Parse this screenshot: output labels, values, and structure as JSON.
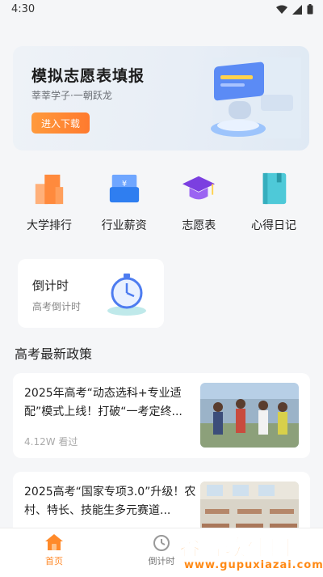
{
  "status_bar": {
    "time": "4:30"
  },
  "banner": {
    "title": "模拟志愿表填报",
    "subtitle": "莘莘学子·一朝跃龙",
    "button": "进入下载"
  },
  "quick_grid": [
    {
      "label": "大学排行",
      "icon": "building-icon",
      "color": "#ff8a3d"
    },
    {
      "label": "行业薪资",
      "icon": "salary-envelope-icon",
      "color": "#2f7ef0"
    },
    {
      "label": "志愿表",
      "icon": "graduation-cap-icon",
      "color": "#7b3fe0"
    },
    {
      "label": "心得日记",
      "icon": "notebook-icon",
      "color": "#4ec9d8"
    }
  ],
  "countdown_card": {
    "title": "倒计时",
    "subtitle": "高考倒计时"
  },
  "section": {
    "title": "高考最新政策"
  },
  "news": [
    {
      "text": "2025年高考“动态选科+专业适配”模式上线！打破“一考定终...",
      "views": "4.12W 看过"
    },
    {
      "text": "2025高考“国家专项3.0”升级！农村、特长、技能生多元赛道...",
      "views": ""
    }
  ],
  "tabbar": [
    {
      "label": "首页",
      "icon": "home-icon",
      "active": true
    },
    {
      "label": "倒计时",
      "icon": "alarm-clock-icon",
      "active": false
    }
  ],
  "watermark": {
    "main": "谷普软件园",
    "url": "www.gupuxiazai.com"
  },
  "colors": {
    "accent": "#ff8a2a",
    "background": "#f5f6f8"
  }
}
